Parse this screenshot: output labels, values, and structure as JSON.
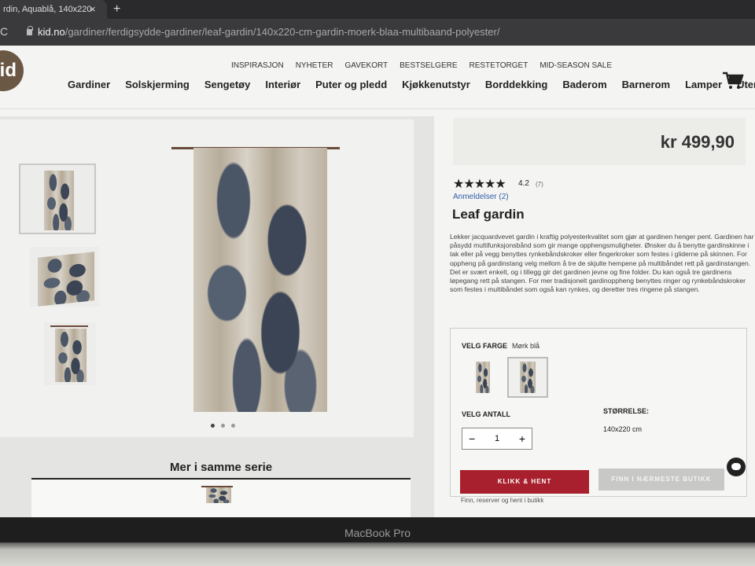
{
  "browser": {
    "tab_title": "rdin, Aquablå, 140x220",
    "tab_close": "×",
    "new_tab": "+",
    "reload": "C",
    "url_host": "kid.no",
    "url_path": "/gardiner/ferdigsydde-gardiner/leaf-gardin/140x220-cm-gardin-moerk-blaa-multibaand-polyester/"
  },
  "site": {
    "logo": "id",
    "top_nav": [
      "INSPIRASJON",
      "NYHETER",
      "GAVEKORT",
      "BESTSELGERE",
      "RESTETORGET",
      "MID-SEASON SALE"
    ],
    "main_nav": [
      "Gardiner",
      "Solskjerming",
      "Sengetøy",
      "Interiør",
      "Puter og pledd",
      "Kjøkkenutstyr",
      "Borddekking",
      "Baderom",
      "Barnerom",
      "Lamper",
      "Uterom"
    ]
  },
  "product": {
    "price": "kr 499,90",
    "stars": "★★★★★",
    "rating": "4.2",
    "rating_count": "(7)",
    "reviews_link": "Anmeldelser (2)",
    "title": "Leaf gardin",
    "description": "Lekker jacquardvevet gardin i kraftig polyesterkvalitet som gjør at gardinen henger pent. Gardinen har påsydd multifunksjonsbånd som gir mange opphengsmuligheter. Ønsker du å benytte gardinskinne i tak eller på vegg benyttes rynkebåndskroker eller fingerkroker som festes i gliderne på skinnen. For oppheng på gardinstang velg mellom å tre de skjulte hempene på multibåndet rett på gardinstangen. Det er svært enkelt, og i tillegg gir det gardinen jevne og fine folder. Du kan også tre gardinens løpegang rett på stangen. For mer tradisjonelt gardinoppheng benyttes ringer og rynkebåndskroker som festes i multibåndet som også kan rynkes, og deretter tres ringene på stangen.",
    "color_label": "VELG FARGE",
    "color_value": "Mørk blå",
    "quantity_label": "VELG ANTALL",
    "quantity": "1",
    "minus": "−",
    "plus": "+",
    "size_label": "STØRRELSE:",
    "size_value": "140x220 cm",
    "click_collect": "KLIKK & HENT",
    "find_store": "FINN I NÆRMESTE BUTIKK",
    "footnote": "Finn, reserver og hent i butikk"
  },
  "gallery": {
    "series_title": "Mer i samme serie",
    "carousel_dots": 3,
    "active_dot": 1
  },
  "laptop": {
    "brand": "MacBook Pro"
  },
  "colors": {
    "accent_red": "#a8202d",
    "link_blue": "#2f5fa8"
  }
}
